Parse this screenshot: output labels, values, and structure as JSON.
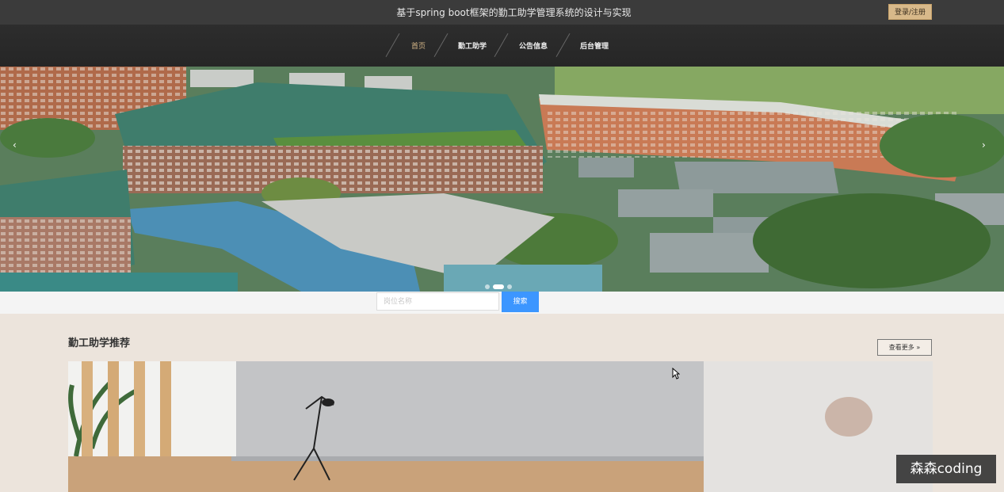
{
  "header": {
    "title": "基于spring boot框架的勤工助学管理系统的设计与实现",
    "login_label": "登录/注册"
  },
  "nav": {
    "items": [
      {
        "label": "首页",
        "active": true
      },
      {
        "label": "勤工助学",
        "active": false
      },
      {
        "label": "公告信息",
        "active": false
      },
      {
        "label": "后台管理",
        "active": false
      }
    ]
  },
  "banner": {
    "prev_icon": "chevron-left-icon",
    "next_icon": "chevron-right-icon",
    "slides_count": 3,
    "active_slide": 2
  },
  "search": {
    "placeholder": "岗位名称",
    "value": "",
    "button_label": "搜索"
  },
  "section": {
    "title": "勤工助学推荐",
    "more_label": "查看更多 »"
  },
  "watermark": {
    "text": "森森coding"
  },
  "colors": {
    "accent": "#d8b98a",
    "search_button": "#3c96ff",
    "topbar": "#3b3b3b",
    "page_bg": "#ece4dc"
  }
}
